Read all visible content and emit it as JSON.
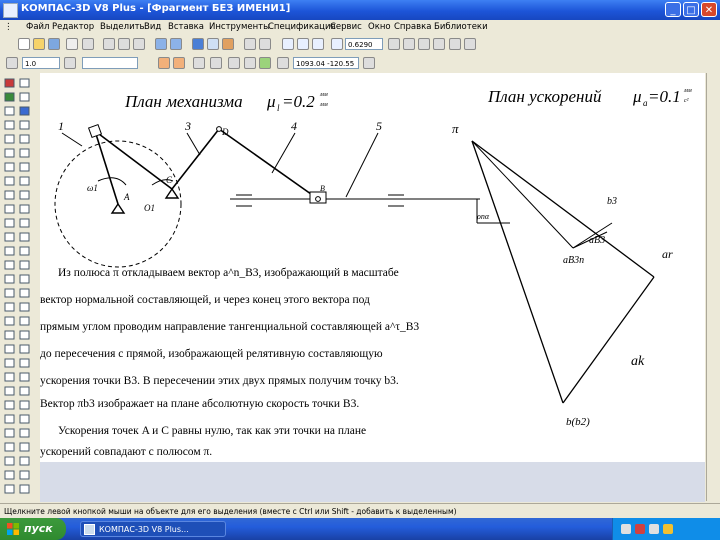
{
  "window": {
    "title": "КОМПАС-3D V8 Plus - [Фрагмент БЕЗ ИМЕНИ1]",
    "min_glyph": "_",
    "max_glyph": "□",
    "close_glyph": "✕"
  },
  "menu": [
    "Файл",
    "Редактор",
    "Выделить",
    "Вид",
    "Вставка",
    "Инструменты",
    "Спецификация",
    "Сервис",
    "Окно",
    "Справка",
    "Библиотеки"
  ],
  "toolbar": {
    "zoom_value": "0.6290",
    "style_value": "1.0",
    "coords_value": "1093.04 -120.55"
  },
  "drawing": {
    "mech_title": "План механизма",
    "mech_scale": "μ",
    "mech_scale_sub": "l",
    "mech_scale_value": "=0.2",
    "mech_scale_units_top": "мм",
    "mech_scale_units_bottom": "мм",
    "accel_title": "План ускорений",
    "accel_scale": "μ",
    "accel_scale_sub": "a",
    "accel_scale_value": "=0.1",
    "accel_scale_units_top": "мм",
    "accel_scale_units_bottom": "с²",
    "labels": {
      "n1": "1",
      "n3": "3",
      "n4": "4",
      "n5": "5",
      "B": "B",
      "D": "D",
      "C": "C",
      "a_O1": "O1",
      "omega1": "ω1",
      "A": "A",
      "pi": "π",
      "b3": "b3",
      "aB3_small": "aB3",
      "aB3n": "aB3n",
      "ar": "ar",
      "ak": "ak",
      "b2": "b(b2)",
      "pna": "ρпα"
    }
  },
  "text": {
    "line1": "Из полюса π откладываем вектор a^n_B3, изображающий в масштабе",
    "line2": "вектор нормальной составляющей, и через конец этого вектора под",
    "line3": "прямым углом проводим направление тангенциальной составляющей a^τ_B3",
    "line4": "до пересечения с прямой, изображающей релятивную составляющую",
    "line5": "ускорения точки B3. В пересечении этих двух прямых получим точку b3.",
    "line6": "Вектор πb3 изображает на плане абсолютную скорость точки B3.",
    "line7": "Ускорения точек A и C равны нулю, так как эти точки на плане",
    "line8": "ускорений совпадают с полюсом π."
  },
  "status": {
    "hint": "Щелкните левой кнопкой мыши на объекте для его выделения (вместе с Ctrl или Shift - добавить к выделенным)"
  },
  "taskbar": {
    "start_label": "пуск",
    "task_label": "КОМПАС-3D V8 Plus...",
    "clock": ""
  }
}
